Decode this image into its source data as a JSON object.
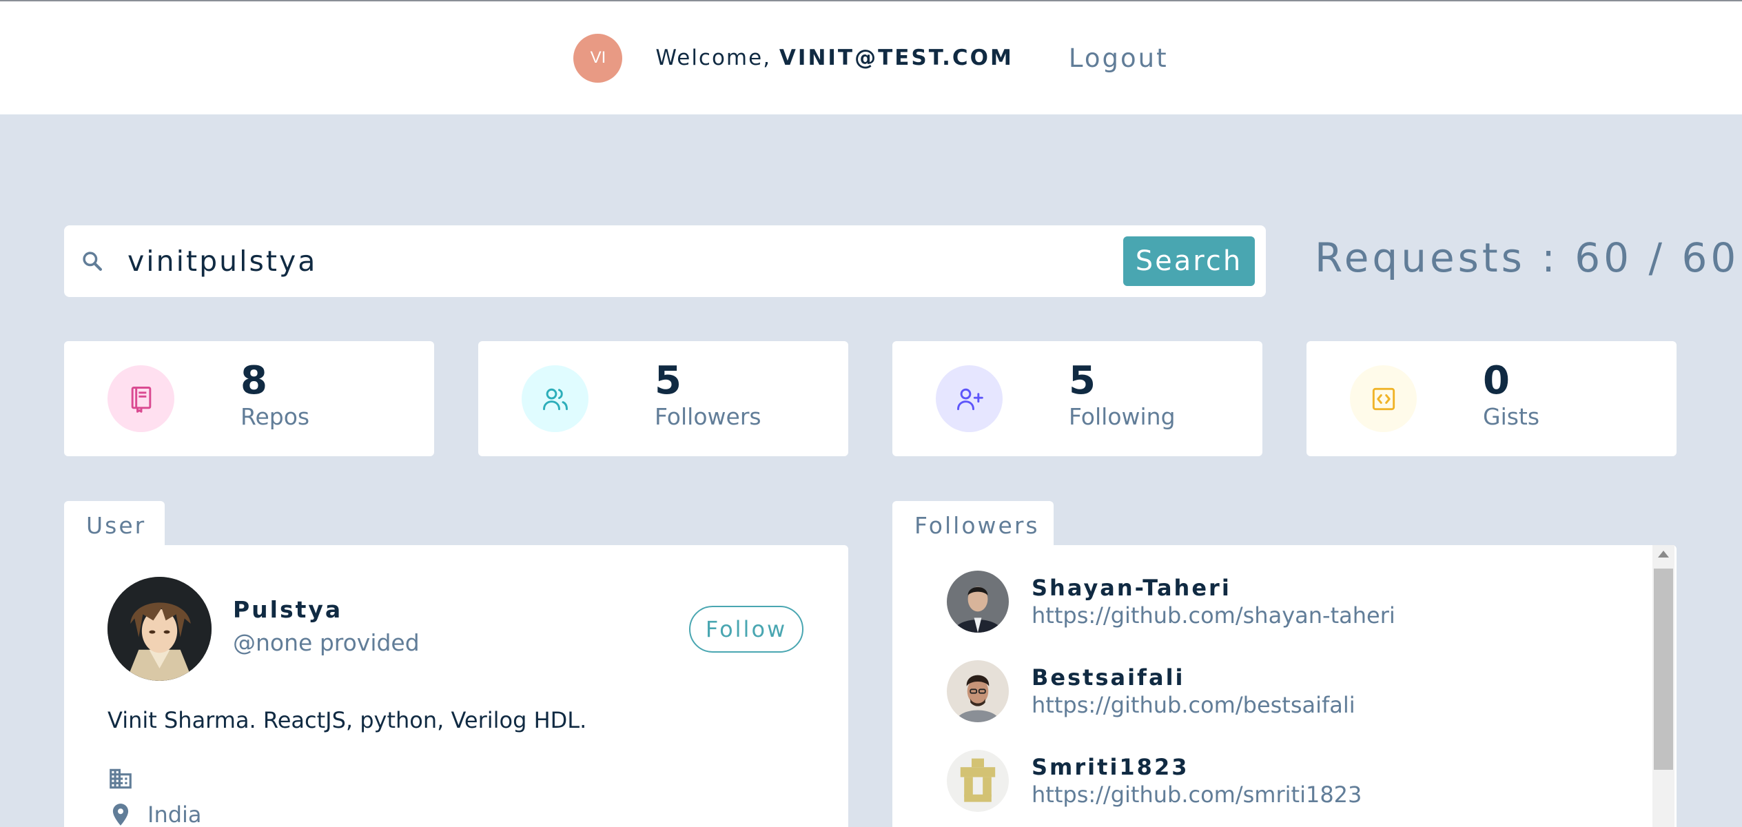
{
  "navbar": {
    "avatar_initials": "VI",
    "welcome_prefix": "Welcome, ",
    "user_email": "VINIT@TEST.COM",
    "logout_label": "Logout"
  },
  "search": {
    "value": "vinitpulstya",
    "button_label": "Search",
    "icon": "search-icon"
  },
  "requests": {
    "label": "Requests : 60 / 60"
  },
  "stats": [
    {
      "value": "8",
      "label": "Repos",
      "icon": "repo-book-icon",
      "color": "#da4a91",
      "bg": "#ffe0f0"
    },
    {
      "value": "5",
      "label": "Followers",
      "icon": "users-icon",
      "color": "#2caeba",
      "bg": "#e0fcff"
    },
    {
      "value": "5",
      "label": "Following",
      "icon": "user-plus-icon",
      "color": "#5d55fa",
      "bg": "#e6e6ff"
    },
    {
      "value": "0",
      "label": "Gists",
      "icon": "code-icon",
      "color": "#f0b429",
      "bg": "#fffbea"
    }
  ],
  "user_section": {
    "tab_label": "User",
    "name": "Pulstya",
    "handle": "@none provided",
    "follow_label": "Follow",
    "bio": "Vinit Sharma. ReactJS, python, Verilog HDL.",
    "location": "India"
  },
  "followers_section": {
    "tab_label": "Followers",
    "items": [
      {
        "name": "Shayan-Taheri",
        "url": "https://github.com/shayan-taheri"
      },
      {
        "name": "Bestsaifali",
        "url": "https://github.com/bestsaifali"
      },
      {
        "name": "Smriti1823",
        "url": "https://github.com/smriti1823"
      }
    ]
  },
  "colors": {
    "accent": "#49a6b1",
    "page_bg": "#dbe2ec",
    "avatar_bg": "#e89a84"
  }
}
